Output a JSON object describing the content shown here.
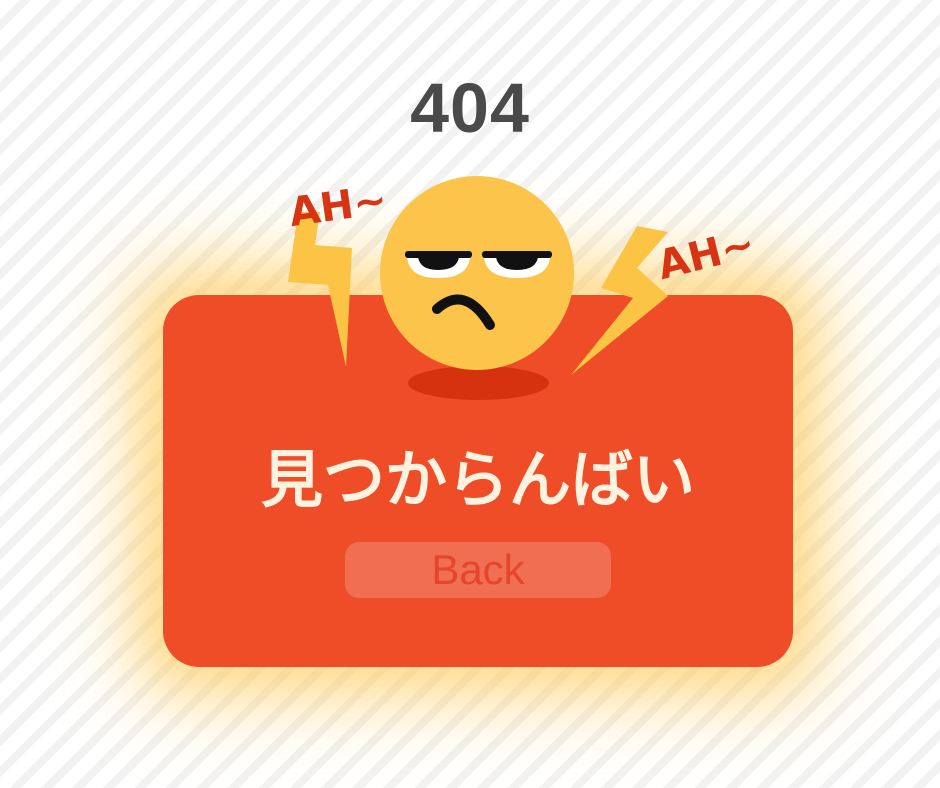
{
  "page": {
    "error_code": "404",
    "message": "見つからんばい",
    "back_label": "Back"
  },
  "illustration": {
    "exclamation_left": "AH~",
    "exclamation_right": "AH~",
    "icons": [
      "angry-face-icon",
      "lightning-bolt-icon"
    ]
  },
  "colors": {
    "card": "#ef4c28",
    "card_glow": "#ffc43c",
    "face": "#fcc44a",
    "bolt": "#fcc444",
    "exclamation": "#d63412",
    "message_text": "#fff3df",
    "code_text": "#4a4a4a",
    "button_bg": "#f06f52",
    "button_text": "#e5452a"
  }
}
